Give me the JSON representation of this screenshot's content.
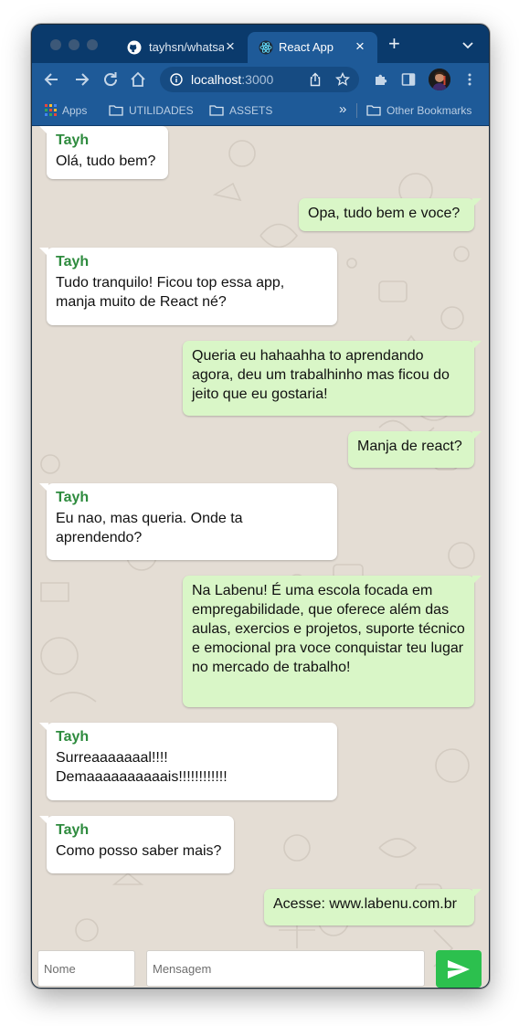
{
  "browser": {
    "tabs": [
      {
        "label": "tayhsn/whatsapp-clone",
        "active": false
      },
      {
        "label": "React App",
        "active": true
      }
    ],
    "address": {
      "host": "localhost",
      "port": ":3000"
    },
    "bookmarks": [
      {
        "label": "Apps",
        "icon": "apps-grid-icon"
      },
      {
        "label": "UTILIDADES",
        "icon": "folder-icon"
      },
      {
        "label": "ASSETS",
        "icon": "folder-icon"
      },
      {
        "label": "Other Bookmarks",
        "icon": "folder-icon"
      }
    ],
    "more_bookmarks": "»"
  },
  "chat": {
    "background_color": "#e4ddd4",
    "incoming_color": "#ffffff",
    "outgoing_color": "#d9f6c7",
    "sender_color": "#2e8b3e",
    "messages": [
      {
        "direction": "in",
        "sender": "Tayh",
        "text": "Olá, tudo bem?"
      },
      {
        "direction": "out",
        "text": "Opa, tudo bem e voce?"
      },
      {
        "direction": "in",
        "sender": "Tayh",
        "text": "Tudo tranquilo! Ficou top essa app, manja muito de React né?"
      },
      {
        "direction": "out",
        "text": "Queria eu hahaahha to aprendando agora, deu um trabalhinho mas ficou do jeito que eu gostaria!"
      },
      {
        "direction": "out",
        "text": "Manja de react?"
      },
      {
        "direction": "in",
        "sender": "Tayh",
        "text": "Eu nao, mas queria. Onde ta aprendendo?"
      },
      {
        "direction": "out",
        "text": "Na Labenu! É uma escola focada em empregabilidade, que oferece além das aulas, exercios e projetos, suporte técnico e emocional pra voce conquistar teu lugar no mercado de trabalho!"
      },
      {
        "direction": "in",
        "sender": "Tayh",
        "text": "Surreaaaaaaal!!!! Demaaaaaaaaaais!!!!!!!!!!!!"
      },
      {
        "direction": "in",
        "sender": "Tayh",
        "text": "Como posso saber mais?"
      },
      {
        "direction": "out",
        "text": "Acesse: www.labenu.com.br"
      }
    ]
  },
  "composer": {
    "name_placeholder": "Nome",
    "message_placeholder": "Mensagem",
    "send_button_color": "#2cc04e",
    "send_icon": "send-arrow-icon"
  }
}
